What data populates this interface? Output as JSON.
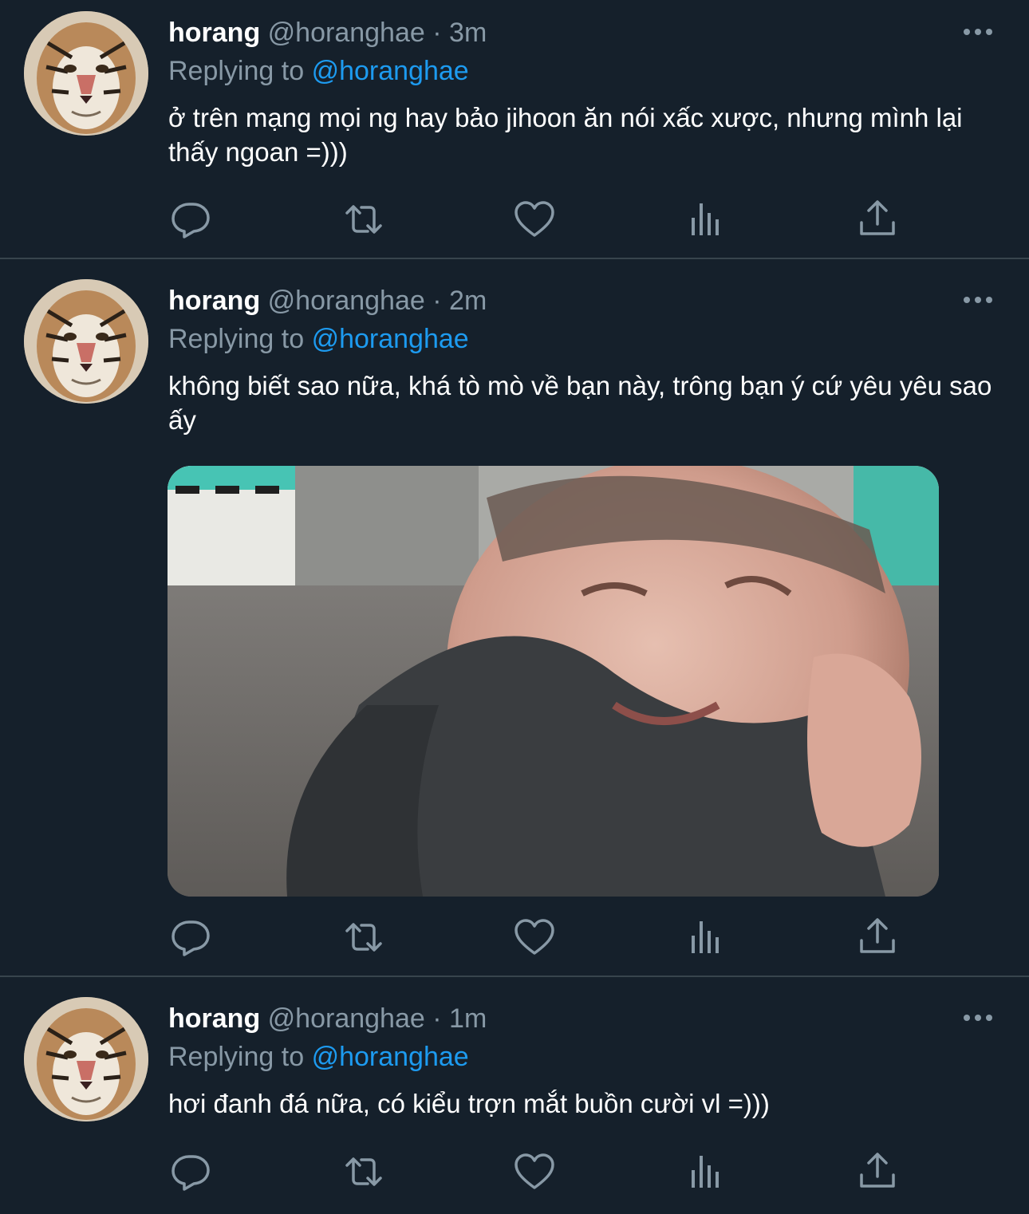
{
  "tweets": [
    {
      "name": "horang",
      "handle": "@horanghae",
      "separator": "·",
      "time": "3m",
      "reply_prefix": "Replying to",
      "reply_handle": "@horanghae",
      "text": "ở trên mạng mọi ng hay bảo jihoon ăn nói xấc xược, nhưng mình lại thấy ngoan =)))",
      "has_media": false
    },
    {
      "name": "horang",
      "handle": "@horanghae",
      "separator": "·",
      "time": "2m",
      "reply_prefix": "Replying to",
      "reply_handle": "@horanghae",
      "text": "không biết sao nữa, khá tò mò về bạn này, trông bạn ý cứ yêu yêu sao ấy",
      "has_media": true
    },
    {
      "name": "horang",
      "handle": "@horanghae",
      "separator": "·",
      "time": "1m",
      "reply_prefix": "Replying to",
      "reply_handle": "@horanghae",
      "text": "hơi đanh đá nữa, có kiểu trợn mắt buồn cười vl =)))",
      "has_media": false
    }
  ],
  "icons": {
    "avatar": "tiger-avatar",
    "more": "more-icon",
    "reply": "reply-icon",
    "retweet": "retweet-icon",
    "like": "like-icon",
    "analytics": "analytics-icon",
    "share": "share-icon"
  },
  "colors": {
    "background": "#15202b",
    "divider": "#38444d",
    "secondary_text": "#8899a6",
    "link": "#1d9bf0",
    "icon": "#8899a6"
  }
}
